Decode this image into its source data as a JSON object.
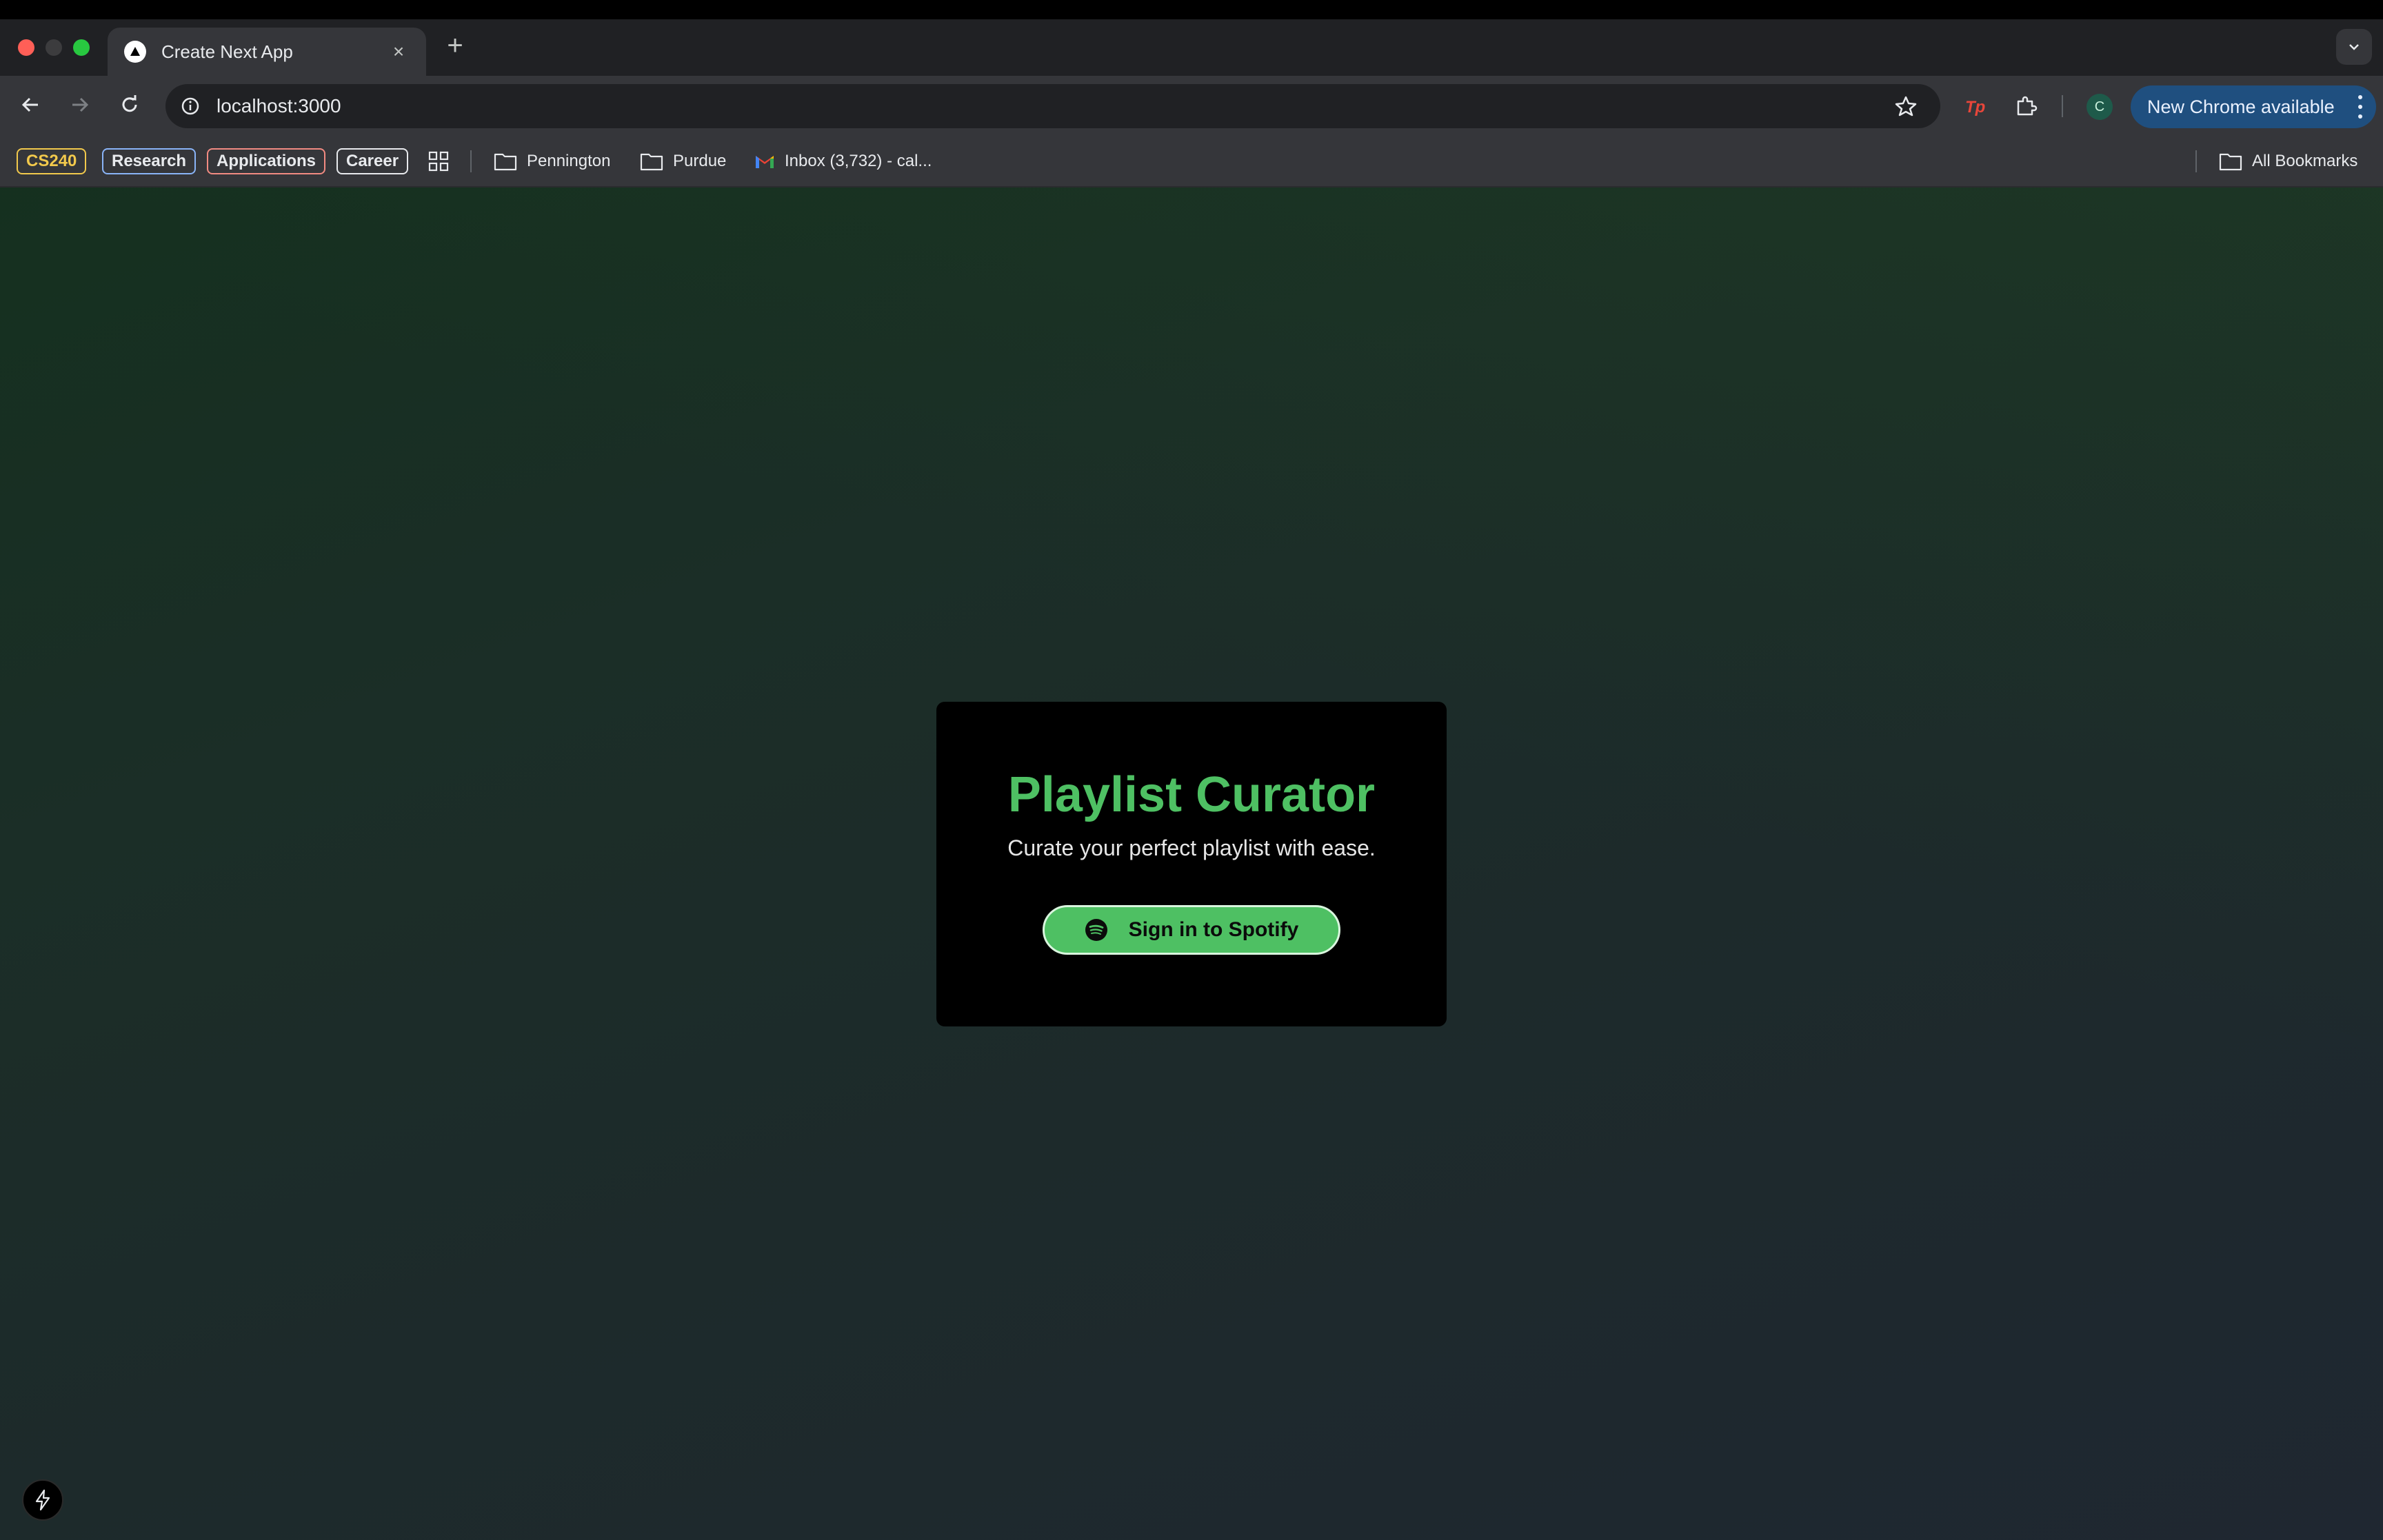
{
  "browser": {
    "tab": {
      "title": "Create Next App",
      "close_label": "×"
    },
    "new_tab_label": "+",
    "address_bar": {
      "url": "localhost:3000"
    },
    "profile_initial": "C",
    "update_button_label": "New Chrome available"
  },
  "bookmarks": {
    "chips": [
      {
        "label": "CS240",
        "color": "#f2c94c"
      },
      {
        "label": "Research",
        "color": "#8ab4f8"
      },
      {
        "label": "Applications",
        "color": "#f28b82"
      },
      {
        "label": "Career",
        "color": "#e8eaed"
      }
    ],
    "folders": [
      {
        "label": "Pennington"
      },
      {
        "label": "Purdue"
      }
    ],
    "gmail": {
      "label": "Inbox (3,732) - cal..."
    },
    "all_bookmarks_label": "All Bookmarks"
  },
  "app": {
    "title": "Playlist Curator",
    "subtitle": "Curate your perfect playlist with ease.",
    "signin_label": "Sign in to Spotify",
    "accent_color": "#4ec063"
  }
}
